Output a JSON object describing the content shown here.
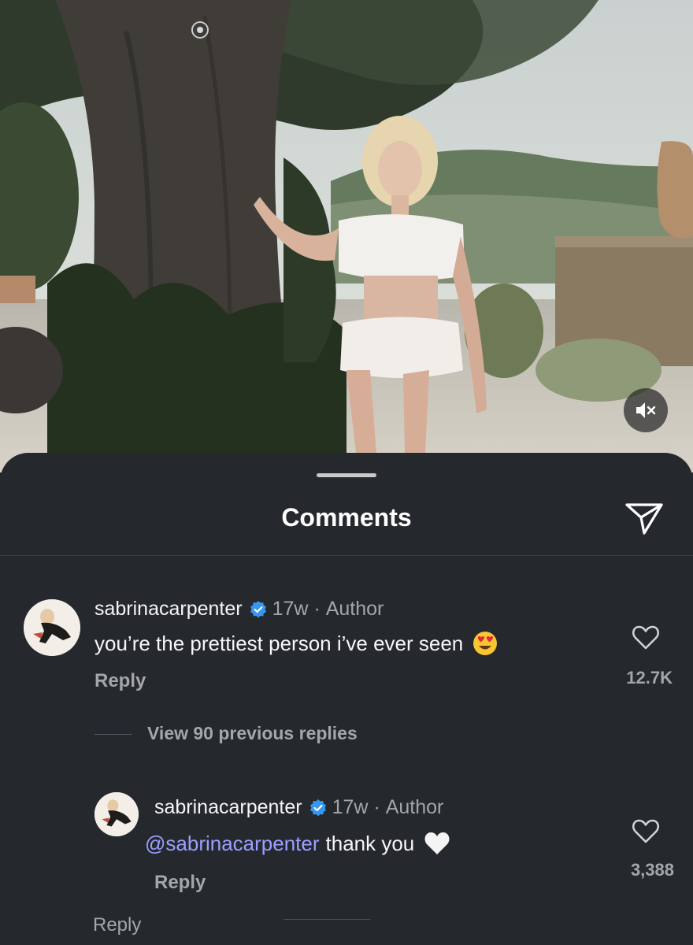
{
  "photo": {
    "description_icons": [
      "info-dot-icon",
      "mute-icon"
    ]
  },
  "sheet": {
    "title": "Comments",
    "share_icon": "send-icon"
  },
  "comment": {
    "username": "sabrinacarpenter",
    "age": "17w",
    "separator": " · ",
    "role": "Author",
    "text": "you’re the prettiest person i’ve ever seen",
    "emoji": "heart-eyes-emoji",
    "reply_label": "Reply",
    "likes": "12.7K"
  },
  "view_replies_label": "View 90 previous replies",
  "reply": {
    "username": "sabrinacarpenter",
    "age": "17w",
    "separator": " · ",
    "role": "Author",
    "mention": "@sabrinacarpenter",
    "text": "thank you",
    "emoji": "white-heart-emoji",
    "reply_label": "Reply",
    "likes": "3,388"
  },
  "bottom_reply_label": "Reply",
  "colors": {
    "background": "#25282d",
    "mention": "#9aa0ff",
    "muted": "#a3a6ab",
    "verified": "#3797f0"
  }
}
